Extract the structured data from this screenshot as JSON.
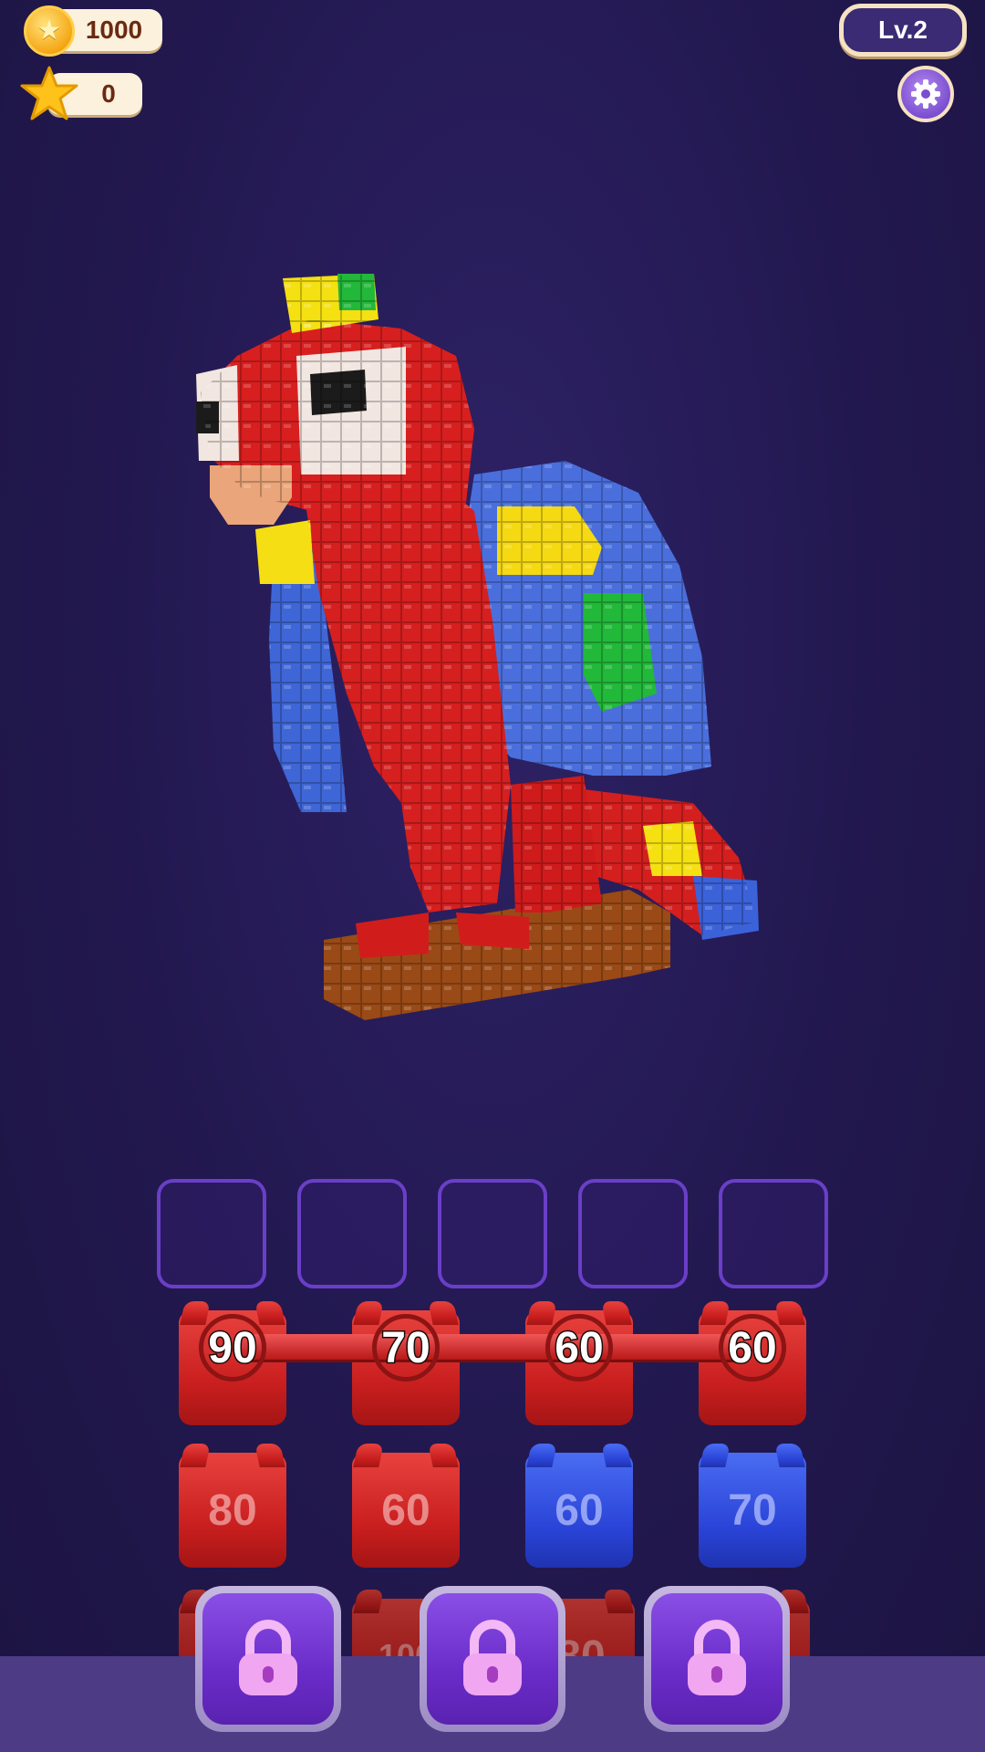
{
  "hud": {
    "coins": "1000",
    "stars": "0",
    "level": "Lv.2"
  },
  "icons": {
    "coin": "coin-icon",
    "star": "star-icon",
    "settings": "gear-icon",
    "lock": "lock-icon"
  },
  "slots": 5,
  "rows": [
    {
      "cups": [
        {
          "value": "90",
          "color": "red"
        },
        {
          "value": "70",
          "color": "red"
        },
        {
          "value": "60",
          "color": "red"
        },
        {
          "value": "60",
          "color": "red"
        }
      ],
      "linked": true
    },
    {
      "cups": [
        {
          "value": "80",
          "color": "red"
        },
        {
          "value": "60",
          "color": "red"
        },
        {
          "value": "60",
          "color": "blue"
        },
        {
          "value": "70",
          "color": "blue"
        }
      ]
    },
    {
      "cups": [
        {
          "value": "100",
          "color": "red"
        },
        {
          "value": "80",
          "color": "red"
        }
      ]
    }
  ],
  "colors": {
    "red": "#c81e1e",
    "blue": "#2a44d8",
    "accent_purple": "#7a4ed0"
  }
}
